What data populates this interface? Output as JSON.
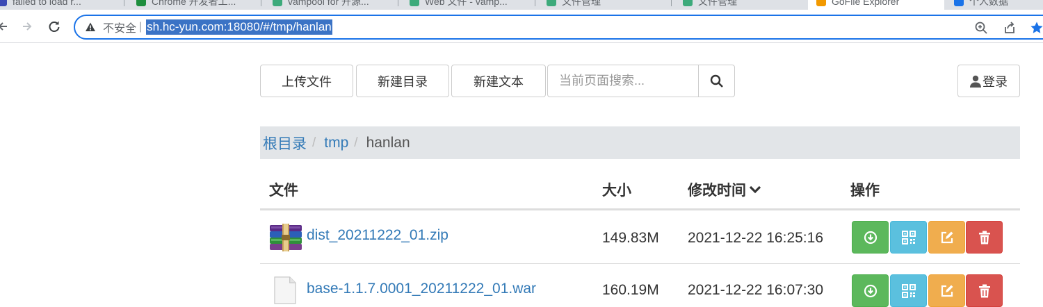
{
  "browser": {
    "tabs": [
      {
        "label": "failed to load r...",
        "favicon_color": "#3c4bb5"
      },
      {
        "label": "Chrome 开发者工...",
        "favicon_color": "#1e8e3e"
      },
      {
        "label": "vampool for 开源...",
        "favicon_color": "#3daa7b"
      },
      {
        "label": "Web 文件 - vamp...",
        "favicon_color": "#3daa7b"
      },
      {
        "label": "文件管理",
        "favicon_color": "#3daa7b"
      },
      {
        "label": "文件管理",
        "favicon_color": "#3daa7b"
      },
      {
        "label": "GoFile Explorer",
        "favicon_color": "#f29900",
        "active": true
      },
      {
        "label": "个人数据",
        "favicon_color": "#1a73e8"
      }
    ],
    "security_label": "不安全",
    "url": "sh.hc-yun.com:18080/#/tmp/hanlan"
  },
  "toolbar": {
    "upload_label": "上传文件",
    "new_dir_label": "新建目录",
    "new_text_label": "新建文本",
    "search_placeholder": "当前页面搜索...",
    "login_label": "登录"
  },
  "breadcrumb": {
    "items": [
      "根目录",
      "tmp"
    ],
    "current": "hanlan"
  },
  "table": {
    "headers": {
      "name": "文件",
      "size": "大小",
      "modified": "修改时间",
      "actions": "操作"
    },
    "sort_column": "modified",
    "rows": [
      {
        "name": "dist_20211222_01.zip",
        "type": "zip",
        "size": "149.83M",
        "modified": "2021-12-22 16:25:16"
      },
      {
        "name": "base-1.1.7.0001_20211222_01.war",
        "type": "file",
        "size": "160.19M",
        "modified": "2021-12-22 16:07:30"
      }
    ]
  },
  "colors": {
    "accent": "#337ab7",
    "download": "#5cb85c",
    "qrcode": "#5bc0de",
    "edit": "#f0ad4e",
    "delete": "#d9534f"
  }
}
